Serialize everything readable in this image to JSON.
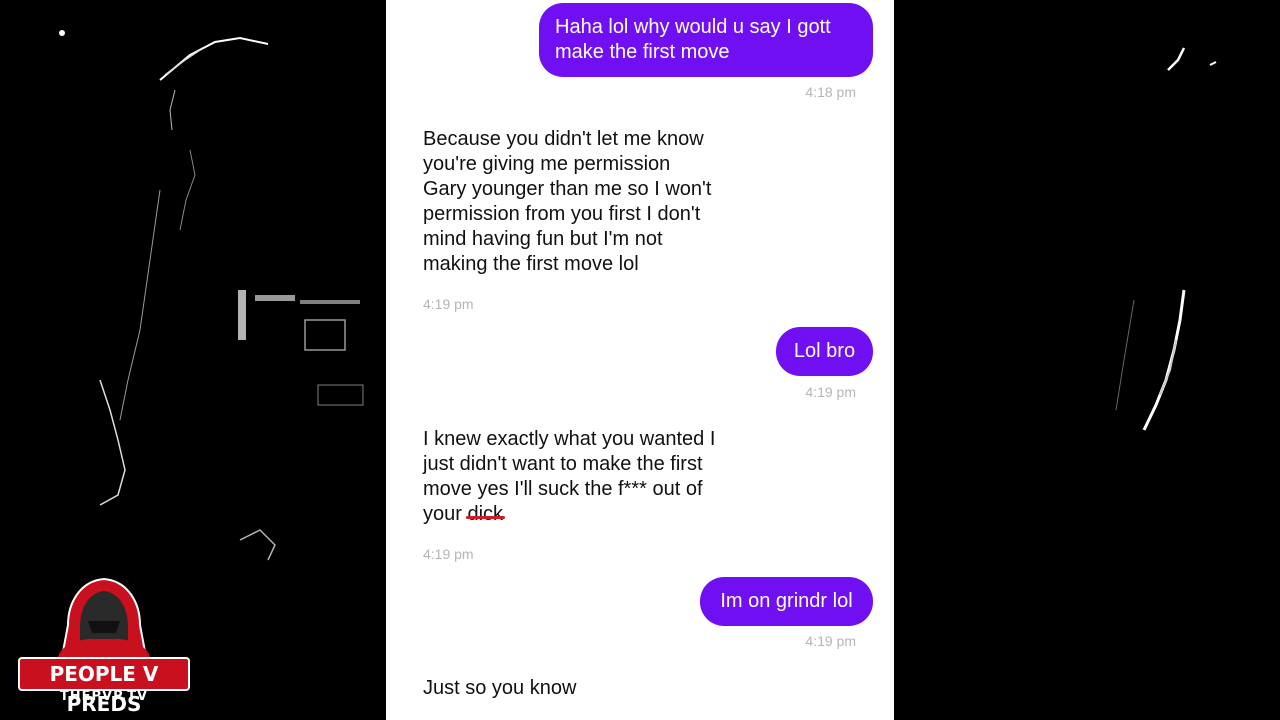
{
  "conversation": {
    "messages": [
      {
        "type": "sent",
        "text": "Haha lol why would u say I gott make the first move",
        "time": "4:18 pm"
      },
      {
        "type": "received",
        "text": "Because you didn't let me know\nyou're giving me permission\nGary younger than me so I won't\npermission from you first I don't\nmind having fun but I'm not\nmaking the first move lol",
        "time": "4:19 pm"
      },
      {
        "type": "sent",
        "text": "Lol bro",
        "time": "4:19 pm"
      },
      {
        "type": "received",
        "text_before_strike": "I knew exactly what you wanted I\njust didn't want to make the first\nmove yes I'll suck the f*** out of\nyour ",
        "struck_text": "dick",
        "time": "4:19 pm"
      },
      {
        "type": "sent",
        "text": "Im on grindr lol",
        "time": "4:19 pm"
      },
      {
        "type": "received",
        "text": "Just so you know"
      }
    ],
    "colors": {
      "sent_bubble": "#7010f2",
      "timestamp": "#b5b5b5",
      "strike_line": "#d11a2a"
    }
  },
  "watermark": {
    "title": "PEOPLE V PREDS",
    "subtitle": "THEPVP.TV",
    "icon": "hooded-figure-icon",
    "accent": "#c8101e"
  }
}
